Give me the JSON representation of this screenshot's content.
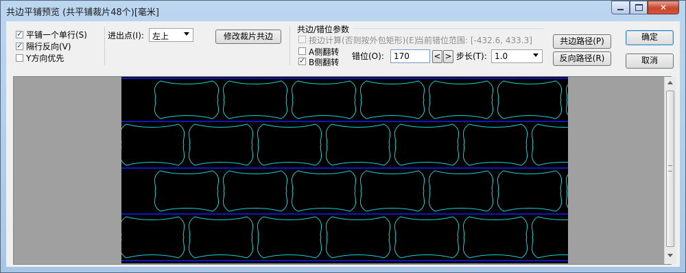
{
  "window": {
    "title": "共边平铺预览 (共平铺裁片48个)[毫米]",
    "minimize_label": "_",
    "maximize_label": "□",
    "close_label": "✕"
  },
  "options": {
    "single_row": {
      "label": "平铺一个单行(S)",
      "checked": true
    },
    "alt_row_reverse": {
      "label": "隔行反向(V)",
      "checked": true
    },
    "y_priority": {
      "label": "Y方向优先",
      "checked": false
    }
  },
  "entry_point": {
    "label": "进出点(I):",
    "value": "左上"
  },
  "modify_button": "修改裁片共边",
  "shared_edge": {
    "group_title": "共边/错位参数",
    "calc_outer_rect": {
      "label": "按边计算(否则按外包矩形)(E)",
      "checked": false,
      "disabled": true
    },
    "range_text": "当前错位范围: [-432.6, 433.3]",
    "a_side_flip": {
      "label": "A侧翻转",
      "checked": false
    },
    "b_side_flip": {
      "label": "B侧翻转",
      "checked": true
    },
    "offset_label": "错位(O):",
    "offset_value": "170",
    "dec_label": "<",
    "inc_label": ">",
    "step_label": "步长(T):",
    "step_value": "1.0"
  },
  "buttons": {
    "shared_path": "共边路径(P)",
    "reverse_path": "反向路径(R)",
    "ok": "确定",
    "cancel": "取消"
  },
  "preview": {
    "background": "#000000",
    "row_line_color": "#1a1aff",
    "piece_color": "#19d3d3"
  }
}
